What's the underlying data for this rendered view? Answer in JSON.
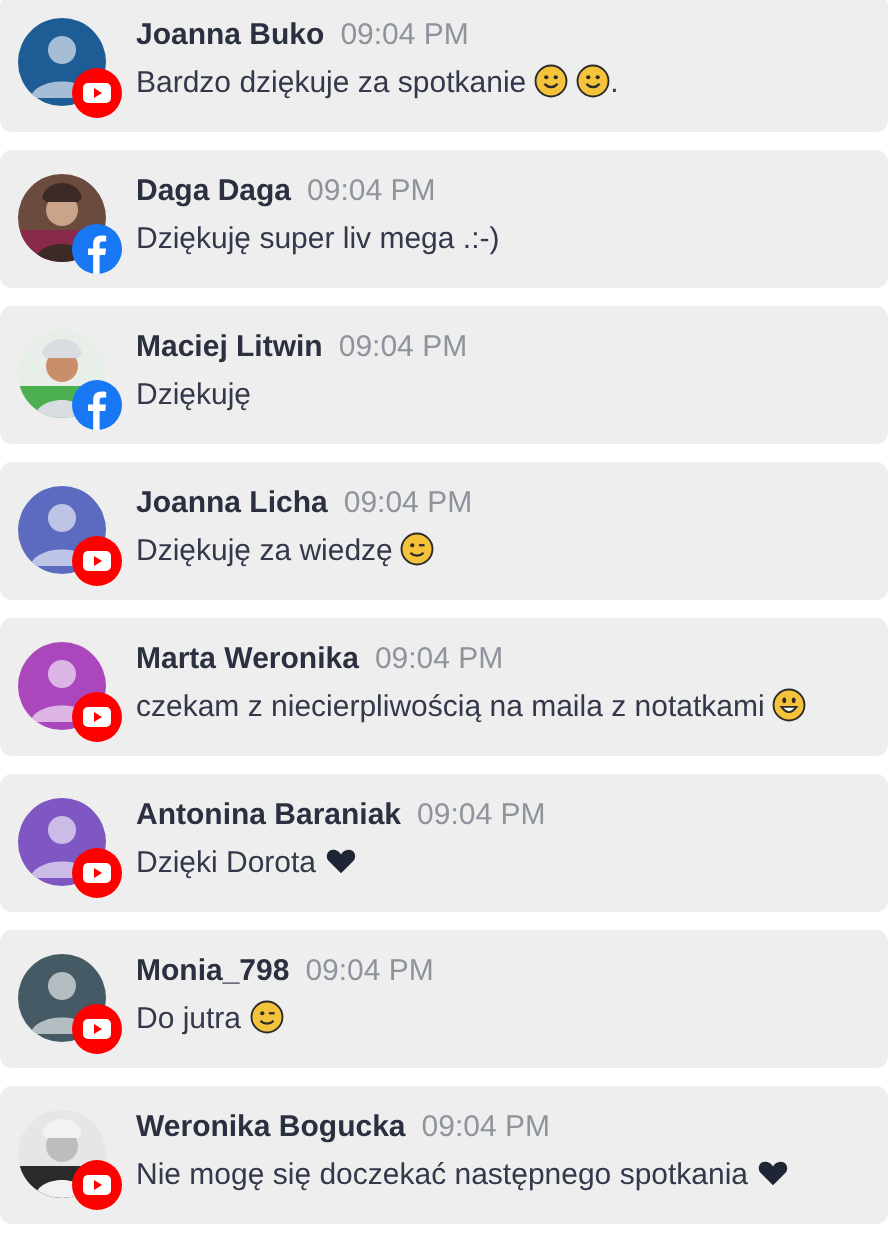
{
  "messages": [
    {
      "name": "Joanna Buko",
      "time": "09:04 PM",
      "badge": {
        "kind": "youtube"
      },
      "avatar": {
        "kind": "silhouette",
        "color": "#1e5c96"
      },
      "parts": [
        {
          "kind": "text",
          "text": "Bardzo dziękuje za spotkanie"
        },
        {
          "kind": "smile"
        },
        {
          "kind": "smile"
        },
        {
          "kind": "text",
          "text": "."
        }
      ]
    },
    {
      "name": "Daga Daga",
      "time": "09:04 PM",
      "badge": {
        "kind": "facebook"
      },
      "avatar": {
        "kind": "picture"
      },
      "parts": [
        {
          "kind": "text",
          "text": "Dziękuję super liv mega .:-)"
        }
      ]
    },
    {
      "name": "Maciej Litwin",
      "time": "09:04 PM",
      "badge": {
        "kind": "facebook"
      },
      "avatar": {
        "kind": "picture"
      },
      "parts": [
        {
          "kind": "text",
          "text": "Dziękuję"
        }
      ]
    },
    {
      "name": "Joanna Licha",
      "time": "09:04 PM",
      "badge": {
        "kind": "youtube"
      },
      "avatar": {
        "kind": "silhouette",
        "color": "#5c6bc0"
      },
      "parts": [
        {
          "kind": "text",
          "text": "Dziękuję za wiedzę"
        },
        {
          "kind": "wink"
        }
      ]
    },
    {
      "name": "Marta Weronika",
      "time": "09:04 PM",
      "badge": {
        "kind": "youtube"
      },
      "avatar": {
        "kind": "silhouette",
        "color": "#ab47bc"
      },
      "parts": [
        {
          "kind": "text",
          "text": "czekam z niecierpliwością na maila z notatkami"
        },
        {
          "kind": "grin"
        }
      ]
    },
    {
      "name": "Antonina Baraniak",
      "time": "09:04 PM",
      "badge": {
        "kind": "youtube"
      },
      "avatar": {
        "kind": "silhouette",
        "color": "#7e57c2"
      },
      "parts": [
        {
          "kind": "text",
          "text": "Dzięki Dorota"
        },
        {
          "kind": "heart"
        }
      ]
    },
    {
      "name": "Monia_798",
      "time": "09:04 PM",
      "badge": {
        "kind": "youtube"
      },
      "avatar": {
        "kind": "silhouette",
        "color": "#455a64"
      },
      "parts": [
        {
          "kind": "text",
          "text": "Do jutra"
        },
        {
          "kind": "wink"
        }
      ]
    },
    {
      "name": "Weronika Bogucka",
      "time": "09:04 PM",
      "badge": {
        "kind": "youtube"
      },
      "avatar": {
        "kind": "picture"
      },
      "parts": [
        {
          "kind": "text",
          "text": "Nie mogę się doczekać następnego spotkania"
        },
        {
          "kind": "heart"
        }
      ]
    }
  ]
}
